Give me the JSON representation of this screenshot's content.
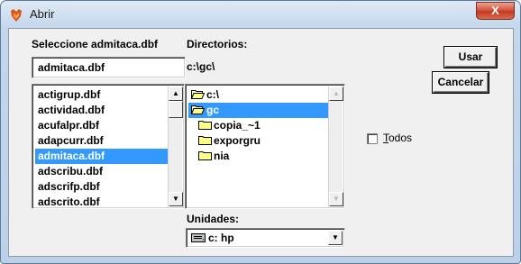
{
  "window": {
    "title": "Abrir",
    "close_glyph": "X",
    "icon": "firefox-like-app-icon"
  },
  "file": {
    "label": "Seleccione admitaca.dbf",
    "name_value": "admitaca.dbf",
    "items": [
      "actigrup.dbf",
      "actividad.dbf",
      "acufalpr.dbf",
      "adapcurr.dbf",
      "admitaca.dbf",
      "adscribu.dbf",
      "adscrifp.dbf",
      "adscrito.dbf"
    ],
    "selected": "admitaca.dbf"
  },
  "dirs": {
    "label": "Directorios:",
    "current_path": "c:\\gc\\",
    "items": [
      {
        "name": "c:\\",
        "state": "open"
      },
      {
        "name": "gc",
        "state": "open-selected"
      },
      {
        "name": "copia_~1",
        "state": "closed"
      },
      {
        "name": "exporgru",
        "state": "closed"
      },
      {
        "name": "nia",
        "state": "closed"
      }
    ]
  },
  "drives": {
    "label": "Unidades:",
    "selected": "c: hp"
  },
  "buttons": {
    "ok": "Usar",
    "cancel": "Cancelar"
  },
  "options": {
    "all_label": "Todos",
    "all_checked": false
  },
  "colors": {
    "selection": "#3399ff",
    "close_button": "#c8432c",
    "dialog_bg": "#f0f0f0"
  }
}
